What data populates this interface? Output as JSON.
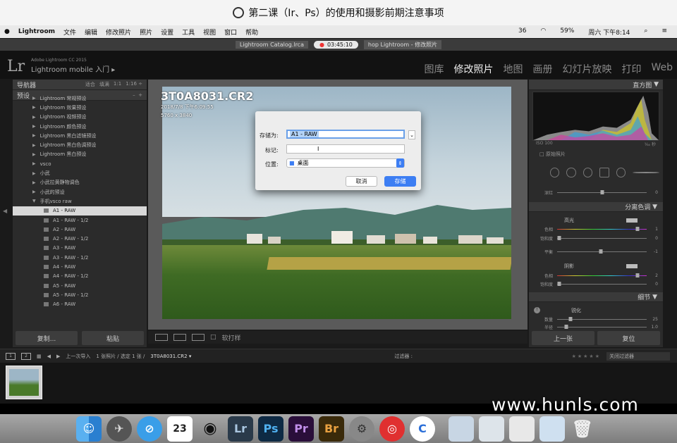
{
  "video_title": "第二课（Ir、Ps）的使用和摄影前期注意事项",
  "menubar": {
    "app": "Lightroom",
    "items": [
      "文件",
      "编辑",
      "修改照片",
      "照片",
      "设置",
      "工具",
      "视图",
      "窗口",
      "帮助"
    ],
    "status": [
      "36",
      "59%",
      "周六 下午8:14"
    ]
  },
  "window": {
    "tab1": "Lightroom Catalog.lrca",
    "recording": "03:45:10",
    "tab2": "hop Lightroom - 修改照片"
  },
  "identity": {
    "logo": "Lr",
    "line1": "Adobe Lightroom CC 2015",
    "line2": "Lightroom mobile 入门 ▸",
    "modules": [
      "图库",
      "修改照片",
      "地图",
      "画册",
      "幻灯片放映",
      "打印",
      "Web"
    ],
    "active_module": "修改照片"
  },
  "left": {
    "navigator": "导航器",
    "nav_opts": [
      "适合",
      "填满",
      "1:1",
      "1:16 ÷"
    ],
    "presets": "预设",
    "items": [
      "Lightroom 常规预设",
      "Lightroom 效果预设",
      "Lightroom 视频预设",
      "Lightroom 颜色预设",
      "Lightroom 黑白滤镜预设",
      "Lightroom 黑白色调预设",
      "Lightroom 黑白预设",
      "vsco",
      "小武",
      "小武拉黄静物调色",
      "小武的预设",
      "手机vsco raw"
    ],
    "sub_items": [
      "A1 - RAW",
      "A1 - RAW - 1/2",
      "A2 - RAW",
      "A2 - RAW - 1/2",
      "A3 - RAW",
      "A3 - RAW - 1/2",
      "A4 - RAW",
      "A4 - RAW - 1/2",
      "A5 - RAW",
      "A5 - RAW - 1/2",
      "A6 - RAW"
    ],
    "copy_btn": "复制...",
    "paste_btn": "粘贴"
  },
  "photo": {
    "filename": "3T0A8031.CR2",
    "datetime": "2018/7/8 下午6:09:55",
    "dimensions": "5760 x 3840"
  },
  "dialog": {
    "save_as_label": "存储为:",
    "save_as_value": "A1 - RAW",
    "tags_label": "标记:",
    "location_label": "位置:",
    "location_value": "桌面",
    "cancel": "取消",
    "save": "存储"
  },
  "toolbar": {
    "softproof": "软打样"
  },
  "right": {
    "histogram": "直方图",
    "iso": "ISO 100",
    "fraction": "¹⁄₆₀ 秒",
    "original_photo": "原始照片",
    "split_toning": "分离色调",
    "highlights": "高光",
    "shadows": "阴影",
    "detail": "细节",
    "sharpening": "锐化",
    "sliders": [
      {
        "label": "深红",
        "value": "0",
        "pos": 0.5
      },
      {
        "label": "色相",
        "value": "1",
        "pos": 0.9
      },
      {
        "label": "饱和度",
        "value": "0",
        "pos": 0.02
      },
      {
        "label": "平衡",
        "value": "-1",
        "pos": 0.49
      },
      {
        "label": "色相",
        "value": "2",
        "pos": 0.9
      },
      {
        "label": "饱和度",
        "value": "0",
        "pos": 0.02
      },
      {
        "label": "数量",
        "value": "25",
        "pos": 0.15
      },
      {
        "label": "半径",
        "value": "1.0",
        "pos": 0.1
      }
    ],
    "prev_btn": "上一张",
    "reset_btn": "复位"
  },
  "filmstrip": {
    "pages": [
      "1",
      "2"
    ],
    "source": "上一次导入",
    "count": "1 张照片 / 选定 1 张 /",
    "selected_file": "3T0A8031.CR2 ▾",
    "filter_label": "过滤器 :",
    "filter_value": "关闭过滤器"
  },
  "dock": {
    "calendar_day": "23",
    "apps": [
      "Lr",
      "Ps",
      "Pr",
      "Br"
    ]
  },
  "watermark": "www.hunls.com",
  "colors": {
    "accent": "#3d7ef3",
    "panel": "#2b2b2b"
  }
}
